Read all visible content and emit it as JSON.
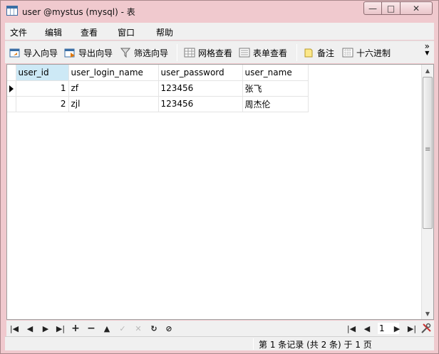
{
  "window": {
    "title": "user @mystus (mysql) - 表"
  },
  "title_buttons": {
    "minimize": "▭",
    "maximize": "□",
    "close": "✕"
  },
  "menu": [
    "文件",
    "编辑",
    "查看",
    "窗口",
    "帮助"
  ],
  "toolbar": {
    "import_wizard": "导入向导",
    "export_wizard": "导出向导",
    "filter_wizard": "筛选向导",
    "grid_view": "网格查看",
    "form_view": "表单查看",
    "memo": "备注",
    "hex": "十六进制",
    "more": "»"
  },
  "grid": {
    "columns": [
      "user_id",
      "user_login_name",
      "user_password",
      "user_name"
    ],
    "rows": [
      [
        "1",
        "zf",
        "123456",
        "张飞"
      ],
      [
        "2",
        "zjl",
        "123456",
        "周杰伦"
      ]
    ]
  },
  "navigation": {
    "first": "|◀",
    "prev": "◀",
    "next": "▶",
    "last": "▶|",
    "add": "+",
    "delete": "−",
    "up": "▲",
    "apply": "✓",
    "discard": "✕",
    "refresh": "↻",
    "stop": "⊘",
    "page_first": "|◀",
    "page_prev": "◀",
    "page_number": "1",
    "page_next": "▶",
    "page_last": "▶|"
  },
  "status": {
    "record_info": "第 1 条记录 (共 2 条) 于 1 页"
  },
  "colors": {
    "frame": "#f0c9ce",
    "header_sorted": "#cde9f6",
    "window_bg": "#f0f0f0"
  }
}
